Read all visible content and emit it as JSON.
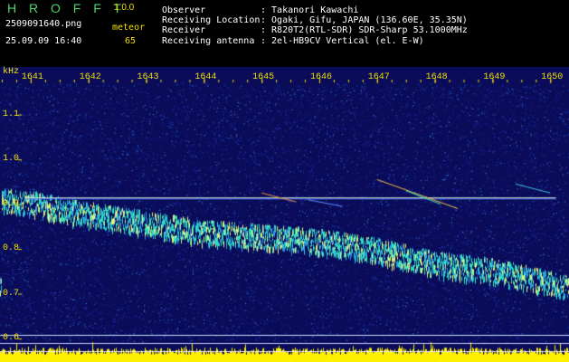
{
  "app": {
    "logo": "H R O F F T",
    "version": "1.0.0"
  },
  "file": {
    "name": "2509091640.png",
    "timestamp": "25.09.09 16:40"
  },
  "counter": {
    "label": "meteor",
    "value": "65"
  },
  "info": [
    {
      "key": "Observer",
      "value": ": Takanori Kawachi"
    },
    {
      "key": "Receiving Location",
      "value": ": Ogaki, Gifu, JAPAN (136.60E, 35.35N)"
    },
    {
      "key": "Receiver",
      "value": ": R820T2(RTL-SDR) SDR-Sharp 53.1000MHz"
    },
    {
      "key": "Receiving antenna",
      "value": ": 2el-HB9CV Vertical (el. E-W)"
    }
  ],
  "colors": {
    "background": "#0a0c5a",
    "text": "#f0e000",
    "carrier": "#d8f0c0",
    "signal": "#30e0c0"
  },
  "chart_data": {
    "type": "heatmap",
    "yunit": "kHz",
    "x_ticks": [
      "1641",
      "1642",
      "1643",
      "1644",
      "1645",
      "1646",
      "1647",
      "1648",
      "1649",
      "1650"
    ],
    "y_ticks": [
      "1.1",
      "1.0",
      "0.9",
      "0.8",
      "0.7",
      "0.6"
    ],
    "xlim": [
      1640.5,
      1650.2
    ],
    "ylim": [
      0.59,
      1.17
    ],
    "carrier_khz": 0.915,
    "drift_trace": [
      {
        "x": 1640.5,
        "y": 0.91
      },
      {
        "x": 1641.0,
        "y": 0.905
      },
      {
        "x": 1642.0,
        "y": 0.88
      },
      {
        "x": 1643.0,
        "y": 0.86
      },
      {
        "x": 1644.0,
        "y": 0.84
      },
      {
        "x": 1645.0,
        "y": 0.83
      },
      {
        "x": 1646.0,
        "y": 0.82
      },
      {
        "x": 1647.0,
        "y": 0.8
      },
      {
        "x": 1648.0,
        "y": 0.77
      },
      {
        "x": 1649.0,
        "y": 0.755
      },
      {
        "x": 1650.2,
        "y": 0.72
      }
    ]
  }
}
